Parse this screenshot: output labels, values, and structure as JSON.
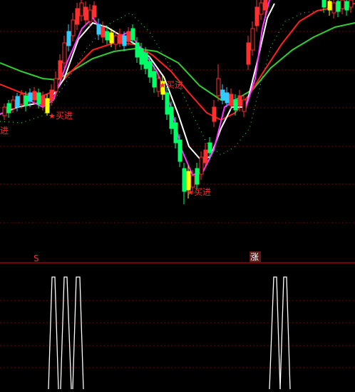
{
  "annotations": {
    "buy_label": "买进",
    "buy_marker": "★"
  },
  "bottom_panel": {
    "left_marker": "S",
    "right_label": "涨"
  },
  "colors": {
    "background": "#000000",
    "grid": "#7a0000",
    "divider": "#c00000",
    "up_candle": "#ff3030",
    "down_candle": "#00ff66",
    "cyan_candle": "#33ccff",
    "white_line": "#ffffff",
    "magenta_line": "#ff33ff",
    "red_line": "#ff2020",
    "green_line": "#33cc33",
    "dotted_line": "#33cc33",
    "text_red": "#ff2a2a",
    "yellow": "#ffff00"
  }
}
